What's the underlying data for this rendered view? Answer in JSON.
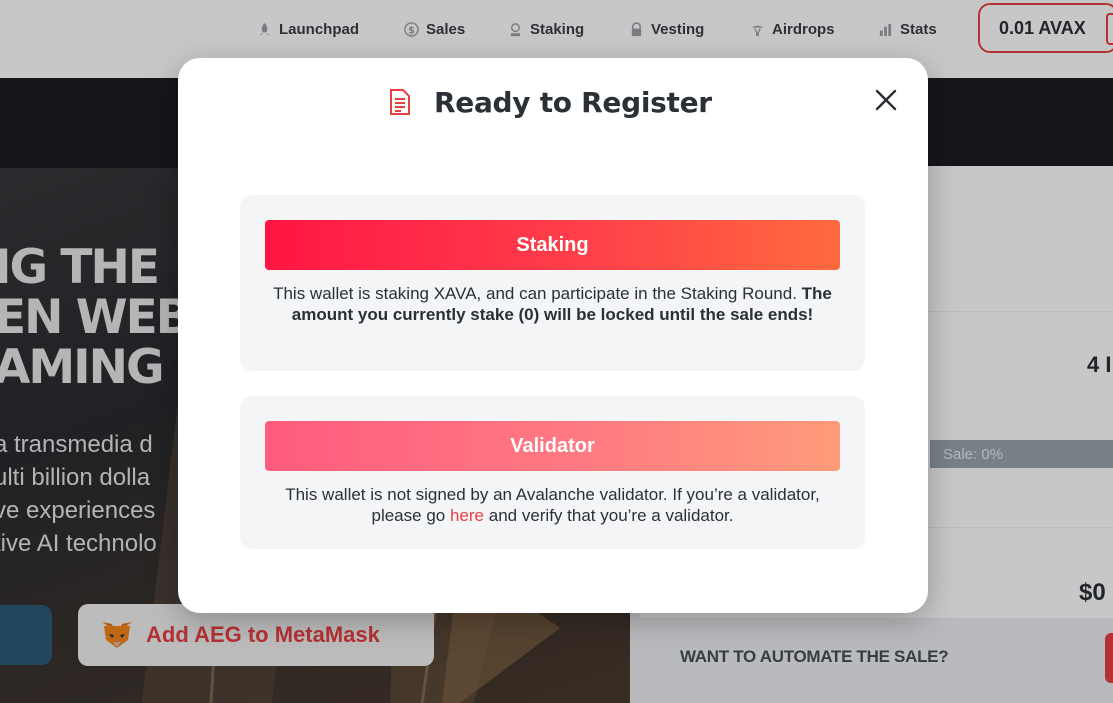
{
  "nav": {
    "items": [
      {
        "label": "Launchpad",
        "icon": "rocket-icon"
      },
      {
        "label": "Sales",
        "icon": "dollar-coin-icon"
      },
      {
        "label": "Staking",
        "icon": "staking-icon"
      },
      {
        "label": "Vesting",
        "icon": "lock-icon"
      },
      {
        "label": "Airdrops",
        "icon": "airdrop-icon"
      },
      {
        "label": "Stats",
        "icon": "bar-chart-icon"
      }
    ],
    "wallet_balance": "0.01 AVAX"
  },
  "hero": {
    "title_lines": [
      "IG THE",
      "EN WEB",
      "AMING"
    ],
    "desc_lines": [
      "a transmedia d",
      "ulti billion dolla",
      "ve experiences",
      "tive AI technolo"
    ],
    "metamask_button": "Add AEG to MetaMask"
  },
  "right_panel": {
    "value_1": "4 I",
    "progress_label": "Sale: 0%",
    "progress": 0,
    "value_2": "$0",
    "automate_heading": "WANT TO AUTOMATE THE SALE?"
  },
  "modal": {
    "title": "Ready to Register",
    "title_icon": "document-icon",
    "close_icon": "close-icon",
    "staking": {
      "button_label": "Staking",
      "desc_plain": "This wallet is staking XAVA, and can participate in the Staking Round.",
      "desc_bold": "The amount you currently stake (0) will be locked until the sale ends!"
    },
    "validator": {
      "button_label": "Validator",
      "desc_before_link": "This wallet is not signed by an Avalanche validator. If you’re a validator, please go",
      "link_text": "here",
      "desc_after_link": "and verify that you’re a validator."
    }
  },
  "colors": {
    "accent": "#e84142",
    "staking_gradient": [
      "#ff1644",
      "#ff6a3d"
    ],
    "validator_gradient": [
      "#ff5c7e",
      "#ff9b7a"
    ]
  }
}
